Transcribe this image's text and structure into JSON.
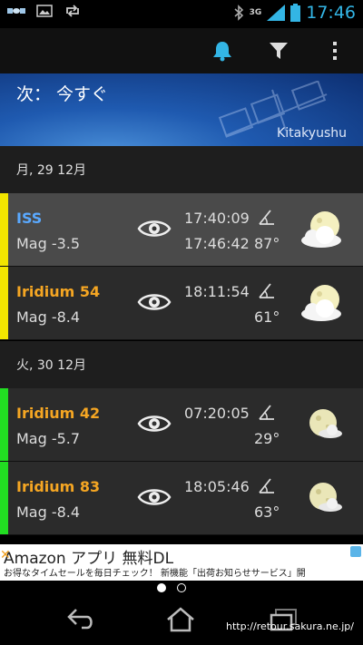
{
  "status_bar": {
    "time": "17:46",
    "network": "3G",
    "icons": [
      "satellite-icon",
      "image-icon",
      "sync-icon",
      "bluetooth-icon",
      "signal-icon",
      "battery-icon"
    ]
  },
  "action_bar": {
    "icons": [
      "bell-icon",
      "filter-icon",
      "overflow-menu-icon"
    ],
    "accent": "#33b5e5"
  },
  "banner": {
    "title": "次： 今すぐ",
    "city": "Kitakyushu"
  },
  "days": [
    {
      "date": "月, 29 12月",
      "passes": [
        {
          "name": "ISS",
          "mag": "Mag -3.5",
          "start": "17:40:09",
          "end": "17:46:42",
          "altitude": "87°",
          "bar_color": "#f2e600",
          "highlight": true,
          "weather": "cloudy-moon-icon"
        },
        {
          "name": "Iridium 54",
          "mag": "Mag -8.4",
          "start": "18:11:54",
          "end": "",
          "altitude": "61°",
          "bar_color": "#f2e600",
          "highlight": false,
          "weather": "cloudy-moon-icon"
        }
      ]
    },
    {
      "date": "火, 30 12月",
      "passes": [
        {
          "name": "Iridium 42",
          "mag": "Mag -5.7",
          "start": "07:20:05",
          "end": "",
          "altitude": "29°",
          "bar_color": "#22dd22",
          "highlight": false,
          "weather": "partly-cloudy-moon-icon"
        },
        {
          "name": "Iridium 83",
          "mag": "Mag -8.4",
          "start": "18:05:46",
          "end": "",
          "altitude": "63°",
          "bar_color": "#22dd22",
          "highlight": false,
          "weather": "partly-cloudy-moon-icon"
        }
      ]
    }
  ],
  "ad": {
    "title": "Amazon アプリ 無料DL",
    "subtitle": "お得なタイムセールを毎日チェック！ 新機能「出荷お知らせサービス」開"
  },
  "pager": {
    "pages": 2,
    "current": 0
  },
  "nav": {
    "url": "http://retour.sakura.ne.jp/",
    "icons": [
      "back-icon",
      "home-icon",
      "recent-apps-icon"
    ]
  }
}
